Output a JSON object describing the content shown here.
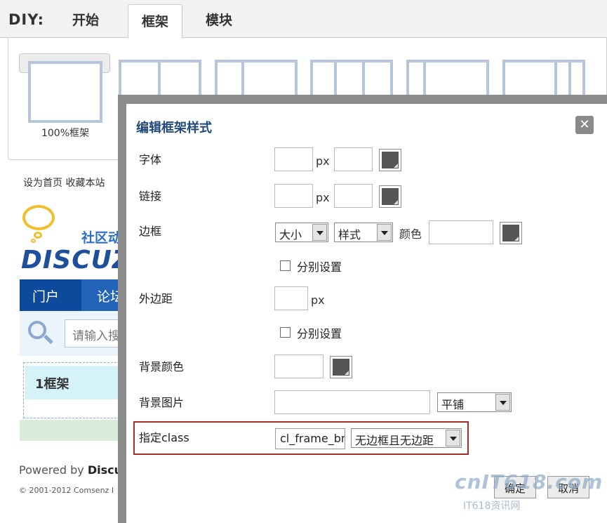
{
  "diy": {
    "label": "DIY:",
    "tabs": [
      {
        "label": "开始"
      },
      {
        "label": "框架"
      },
      {
        "label": "模块"
      }
    ]
  },
  "frames": {
    "selected_caption": "100%框架"
  },
  "page": {
    "top_links": "设为首页  收藏本站",
    "community_text": "社区动",
    "logo_text": "DISCUZ",
    "nav": [
      "门户",
      "论坛"
    ],
    "search_placeholder": "请输入搜",
    "frame_label": "1框架",
    "powered_prefix": "Powered by ",
    "powered_brand": "Discuz",
    "copyright": "© 2001-2012 Comsenz I"
  },
  "dialog": {
    "title": "编辑框架样式",
    "close_glyph": "✕",
    "fields": {
      "font_label": "字体",
      "link_label": "链接",
      "border_label": "边框",
      "margin_label": "外边距",
      "bg_color_label": "背景颜色",
      "bg_image_label": "背景图片",
      "class_label": "指定class"
    },
    "unit_px": "px",
    "border_size_select": "大小",
    "border_style_select": "样式",
    "border_color_label": "颜色",
    "separate_setting": "分别设置",
    "bg_repeat_select": "平铺",
    "class_input_value": "cl_frame_bm",
    "class_select": "无边框且无边距",
    "ok_button": "确定",
    "cancel_button": "取消"
  },
  "watermark": {
    "brand": "cnIT618.com",
    "sub": "IT618资讯网"
  }
}
